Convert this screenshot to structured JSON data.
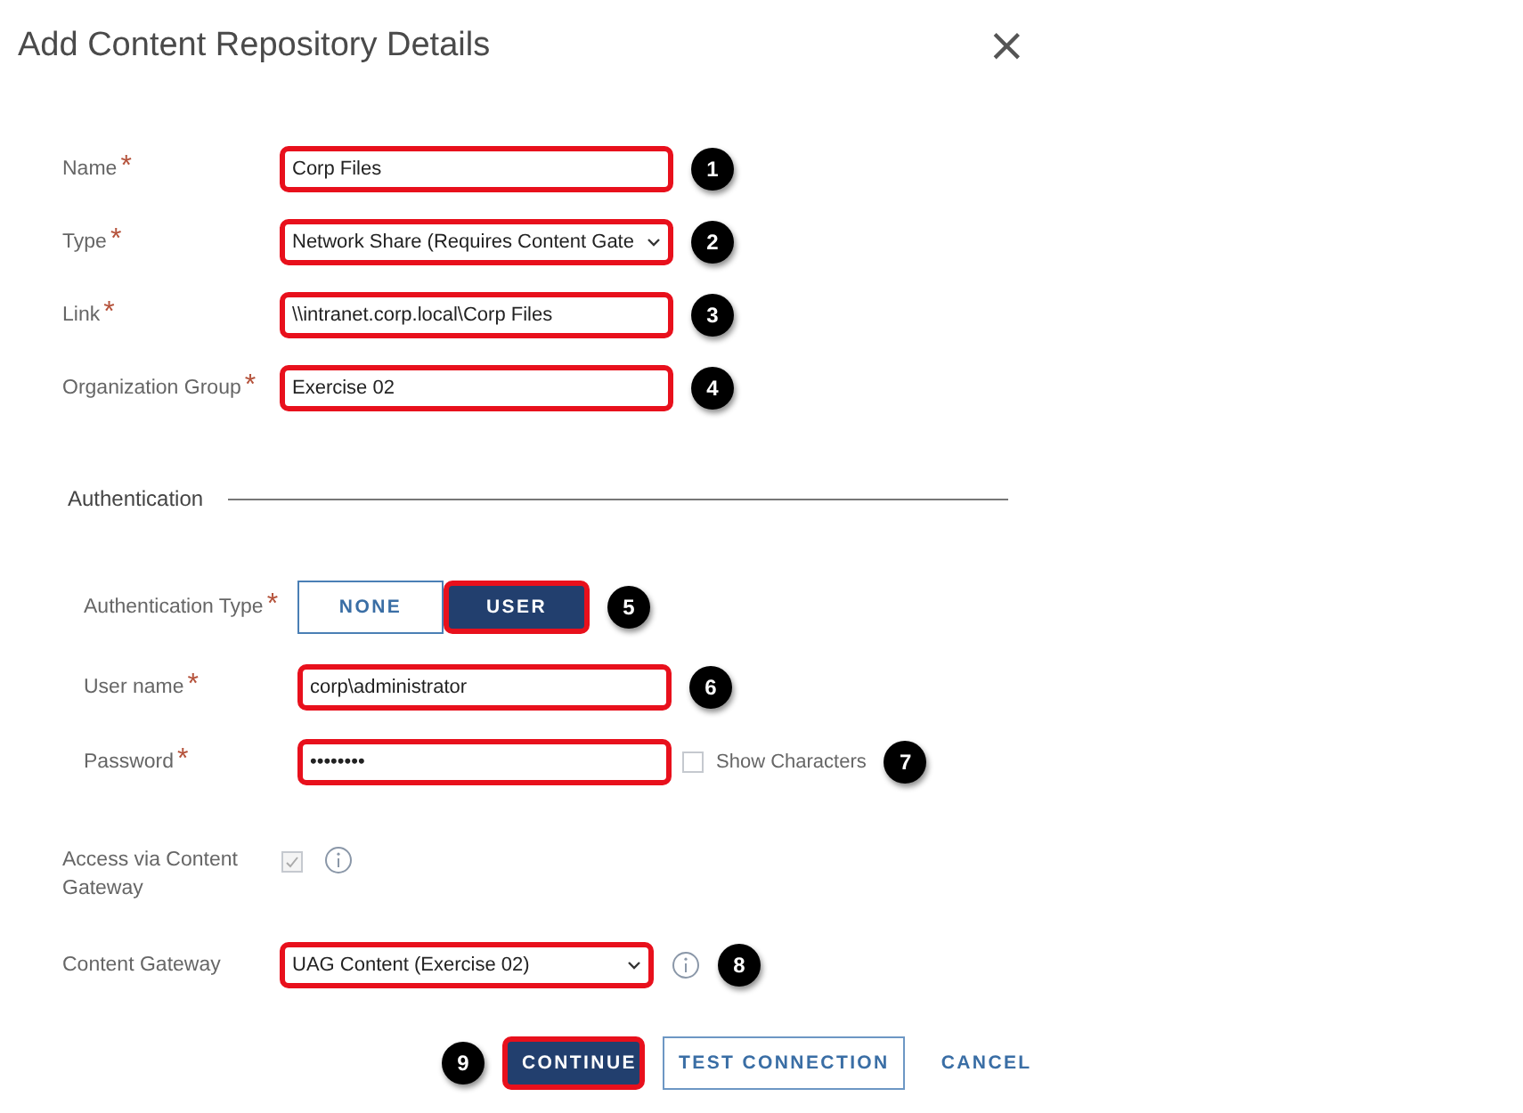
{
  "dialog": {
    "title": "Add Content Repository Details",
    "close": "×"
  },
  "fields": [
    {
      "label": "Name",
      "required": "*",
      "kind": "text",
      "value": "Corp Files",
      "highlighted": true,
      "callout": "1"
    },
    {
      "label": "Type",
      "required": "*",
      "kind": "select",
      "value": "Network Share (Requires Content Gate",
      "highlighted": true,
      "callout": "2"
    },
    {
      "label": "Link",
      "required": "*",
      "kind": "text",
      "value": "\\\\intranet.corp.local\\Corp Files",
      "highlighted": true,
      "callout": "3"
    },
    {
      "label": "Organization Group",
      "required": "*",
      "kind": "text",
      "value": "Exercise 02",
      "highlighted": true,
      "callout": "4"
    }
  ],
  "authentication": {
    "heading": "Authentication",
    "fields": [
      {
        "label": "Authentication Type",
        "required": "*",
        "kind": "toggle",
        "options": [
          {
            "label": "NONE",
            "selected": false,
            "highlighted": false
          },
          {
            "label": "USER",
            "selected": true,
            "highlighted": true
          }
        ],
        "callout": "5"
      },
      {
        "label": "User name",
        "required": "*",
        "kind": "text",
        "value": "corp\\administrator",
        "highlighted": true,
        "callout": "6"
      },
      {
        "label": "Password",
        "required": "*",
        "kind": "password",
        "value": "••••••••",
        "highlighted": true,
        "show_characters": {
          "label": "Show Characters",
          "checked": false
        },
        "callout": "7"
      }
    ]
  },
  "gateway_fields": [
    {
      "label": "Access via Content Gateway",
      "kind": "checkbox",
      "checked": true,
      "disabled": true,
      "info": true
    },
    {
      "label": "Content Gateway",
      "kind": "select",
      "value": "UAG Content (Exercise 02)",
      "highlighted": true,
      "info": true,
      "callout": "8"
    }
  ],
  "buttons": [
    {
      "label": "CONTINUE",
      "kind": "primary",
      "highlighted": true,
      "callout": "9"
    },
    {
      "label": "TEST CONNECTION",
      "kind": "secondary",
      "highlighted": false
    },
    {
      "label": "CANCEL",
      "kind": "link",
      "highlighted": false
    }
  ]
}
